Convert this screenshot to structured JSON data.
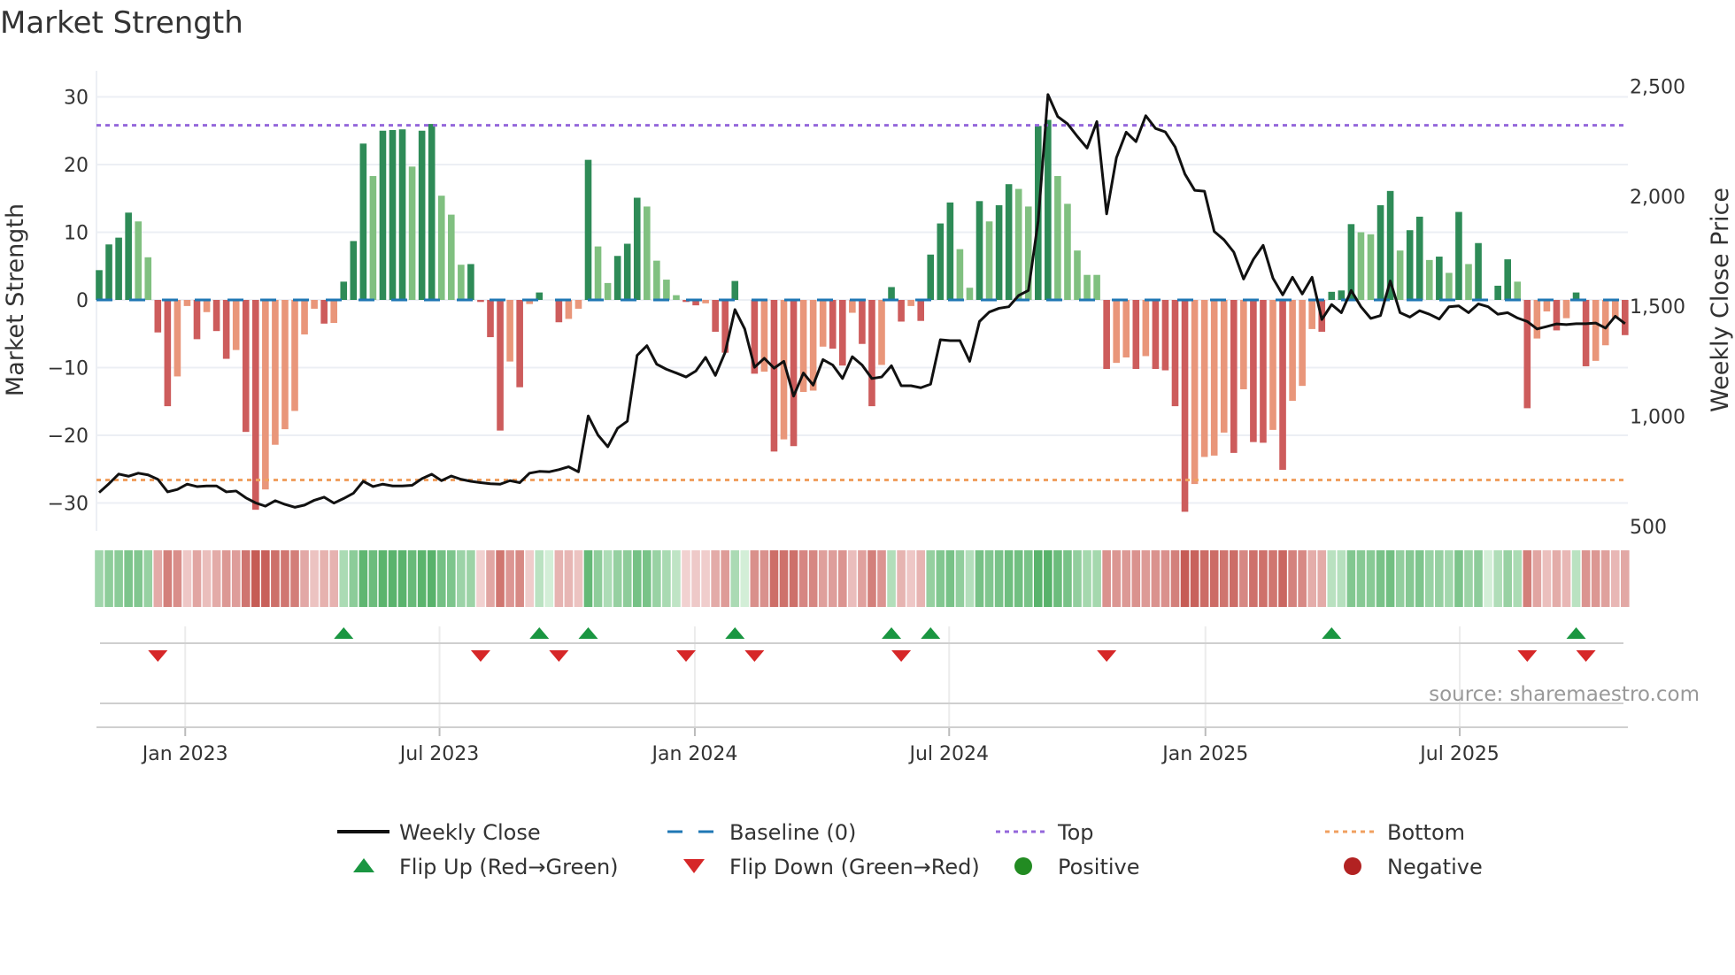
{
  "title": "Market Strength",
  "source": "source: sharemaestro.com",
  "colors": {
    "strong_green": "#2e8b57",
    "weak_green": "#80c080",
    "strong_red": "#cd5c5c",
    "weak_red": "#e9967a",
    "close": "#111111",
    "baseline": "#1f77b4",
    "top": "#9467db",
    "bottom": "#f0a060",
    "flip_up": "#1a9641",
    "flip_down": "#d62728",
    "positive": "#228b22",
    "negative": "#b22222"
  },
  "legend": [
    {
      "label": "Weekly Close",
      "icon": "solid-line"
    },
    {
      "label": "Baseline (0)",
      "icon": "dashed-line"
    },
    {
      "label": "Top",
      "icon": "dotted-line"
    },
    {
      "label": "Bottom",
      "icon": "dotted-line"
    },
    {
      "label": "Flip Up (Red→Green)",
      "icon": "triangle-up"
    },
    {
      "label": "Flip Down (Green→Red)",
      "icon": "triangle-down"
    },
    {
      "label": "Positive",
      "icon": "circle"
    },
    {
      "label": "Negative",
      "icon": "circle"
    }
  ],
  "chart_data": {
    "type": "bar",
    "title": "Market Strength",
    "ylabel": "Market Strength",
    "y2label": "Weekly Close Price",
    "ylim": [
      -33,
      33
    ],
    "y2lim": [
      500,
      2600
    ],
    "yticks": [
      "30",
      "20",
      "10",
      "0",
      "−10",
      "−20",
      "−30"
    ],
    "ytick_values": [
      30,
      20,
      10,
      0,
      -10,
      -20,
      -30
    ],
    "y2ticks": [
      "2,500",
      "2,000",
      "1,500",
      "1,000",
      "500"
    ],
    "y2tick_values": [
      2500,
      2000,
      1500,
      1000,
      500
    ],
    "xticks": [
      {
        "label": "Jan 2023",
        "week": 8.8
      },
      {
        "label": "Jul 2023",
        "week": 34.8
      },
      {
        "label": "Jan 2024",
        "week": 60.9
      },
      {
        "label": "Jul 2024",
        "week": 86.9
      },
      {
        "label": "Jan 2025",
        "week": 113.1
      },
      {
        "label": "Jul 2025",
        "week": 139.1
      }
    ],
    "top_level": 25.8,
    "bottom_level": -26.6,
    "baseline": 0,
    "strength": [
      4.4,
      8.2,
      9.2,
      12.9,
      11.6,
      6.3,
      -4.8,
      -15.7,
      -11.3,
      -0.9,
      -5.8,
      -1.8,
      -4.6,
      -8.7,
      -7.4,
      -19.5,
      -31,
      -28,
      -21.4,
      -19.1,
      -16.4,
      -5.1,
      -1.3,
      -3.5,
      -3.4,
      2.7,
      8.7,
      23.1,
      18.3,
      25,
      25.1,
      25.2,
      19.7,
      25,
      26,
      15.4,
      12.6,
      5.2,
      5.3,
      -0.3,
      -5.5,
      -19.3,
      -9.1,
      -12.9,
      -0.6,
      1.1,
      0,
      -3.3,
      -2.8,
      -1.3,
      20.7,
      7.9,
      2.5,
      6.5,
      8.3,
      15.1,
      13.8,
      5.8,
      3.0,
      0.7,
      -0.3,
      -0.8,
      -0.5,
      -4.7,
      -7.8,
      2.8,
      0,
      -10.9,
      -10.6,
      -22.4,
      -20.6,
      -21.6,
      -13.6,
      -13.4,
      -6.9,
      -7.2,
      -9.7,
      -1.9,
      -6.5,
      -15.7,
      -9.6,
      1.9,
      -3.2,
      -0.9,
      -3.1,
      6.7,
      11.3,
      14.4,
      7.5,
      1.8,
      14.6,
      11.6,
      14.0,
      17.1,
      16.4,
      13.8,
      25.7,
      26.6,
      18.3,
      14.2,
      7.3,
      3.7,
      3.7,
      -10.2,
      -9.3,
      -8.5,
      -10.2,
      -8.3,
      -10.2,
      -10.4,
      -15.7,
      -31.3,
      -27.2,
      -23.2,
      -23.0,
      -19.6,
      -22.6,
      -13.2,
      -21.0,
      -21.1,
      -19.2,
      -25.1,
      -14.9,
      -12.7,
      -4.3,
      -4.7,
      1.2,
      1.4,
      11.2,
      10.0,
      9.7,
      14.0,
      16.1,
      7.3,
      10.3,
      12.3,
      5.9,
      6.4,
      4.0,
      13.0,
      5.3,
      8.4,
      0,
      2.1,
      6.0,
      2.7,
      -16.0,
      -5.7,
      -1.7,
      -4.5,
      -2.7,
      1.1,
      -9.8,
      -9.0,
      -6.7,
      -2.7,
      -5.2
    ],
    "weekly_close": [
      654,
      694,
      738,
      728,
      742,
      734,
      714,
      657,
      668,
      692,
      681,
      684,
      684,
      657,
      661,
      630,
      607,
      592,
      617,
      600,
      587,
      597,
      619,
      633,
      606,
      627,
      651,
      705,
      681,
      692,
      684,
      684,
      687,
      717,
      737,
      708,
      729,
      714,
      705,
      699,
      694,
      692,
      708,
      699,
      742,
      750,
      748,
      758,
      771,
      748,
      1002,
      915,
      862,
      946,
      978,
      1277,
      1321,
      1237,
      1214,
      1197,
      1179,
      1206,
      1268,
      1186,
      1291,
      1485,
      1397,
      1223,
      1264,
      1219,
      1250,
      1092,
      1197,
      1142,
      1258,
      1233,
      1172,
      1271,
      1233,
      1172,
      1179,
      1230,
      1139,
      1139,
      1130,
      1146,
      1348,
      1344,
      1344,
      1250,
      1431,
      1474,
      1491,
      1498,
      1549,
      1572,
      1887,
      2462,
      2362,
      2329,
      2272,
      2219,
      2339,
      1920,
      2175,
      2291,
      2248,
      2366,
      2308,
      2292,
      2224,
      2101,
      2027,
      2023,
      1840,
      1802,
      1746,
      1624,
      1713,
      1777,
      1628,
      1552,
      1632,
      1556,
      1632,
      1440,
      1508,
      1471,
      1572,
      1498,
      1445,
      1458,
      1615,
      1471,
      1451,
      1480,
      1464,
      1442,
      1498,
      1502,
      1471,
      1511,
      1498,
      1464,
      1471,
      1447,
      1431,
      1397,
      1408,
      1420,
      1417,
      1421,
      1421,
      1424,
      1401,
      1455,
      1421
    ],
    "flip_up_weeks": [
      25,
      45,
      50,
      65,
      81,
      85,
      126,
      151
    ],
    "flip_down_weeks": [
      6,
      39,
      47,
      60,
      67,
      82,
      103,
      146,
      152
    ]
  }
}
